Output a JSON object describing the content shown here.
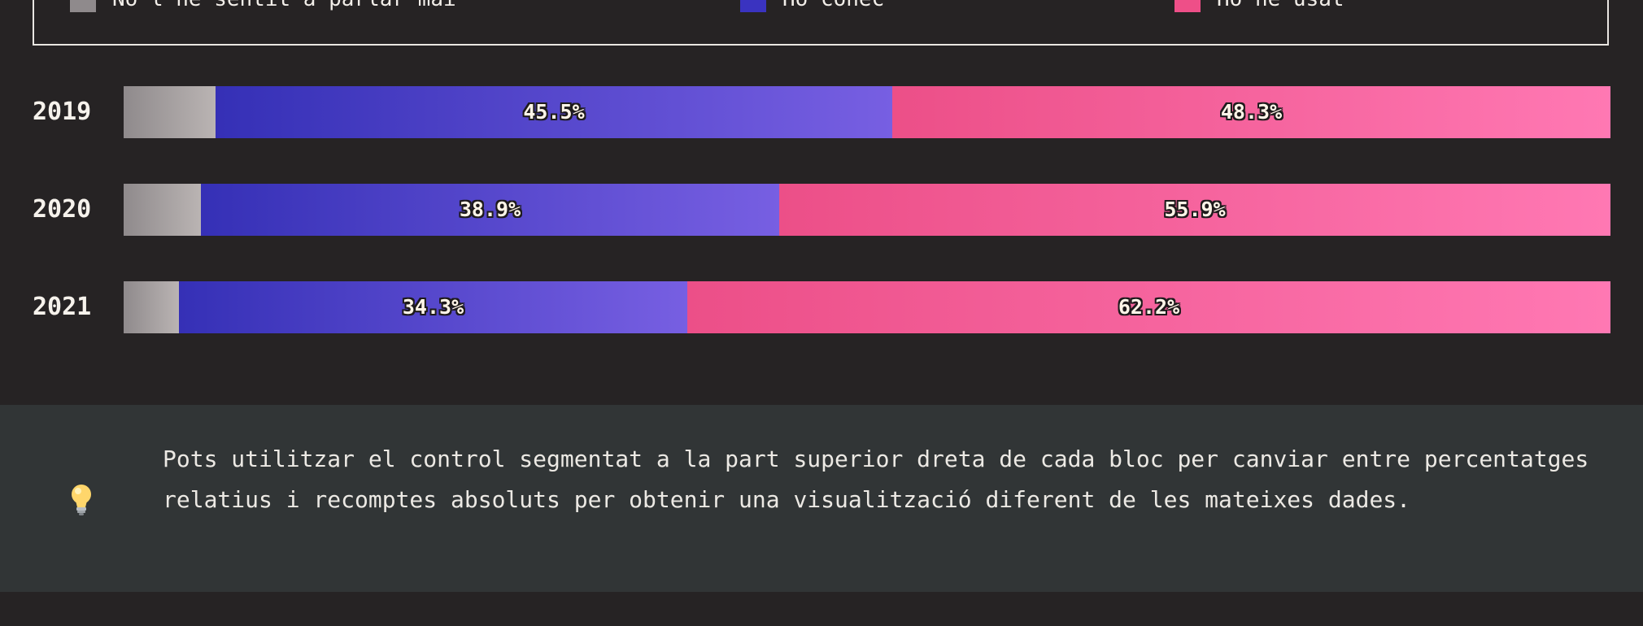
{
  "legend": [
    {
      "label": "No l'he sentit a parlar mai",
      "color": "#8f8a8c"
    },
    {
      "label": "Ho conec",
      "color": "#3a33c0"
    },
    {
      "label": "Ho he usat",
      "color": "#ee4f88"
    }
  ],
  "chart_data": {
    "type": "bar",
    "orientation": "horizontal",
    "stacked": true,
    "normalized": true,
    "categories": [
      "2019",
      "2020",
      "2021"
    ],
    "series": [
      {
        "name": "No l'he sentit a parlar mai",
        "values": [
          6.2,
          5.2,
          3.7
        ],
        "color": "#8f8a8c",
        "value_labels": [
          "",
          "",
          ""
        ]
      },
      {
        "name": "Ho conec",
        "values": [
          45.5,
          38.9,
          34.3
        ],
        "color": "#3a33c0",
        "value_labels": [
          "45.5%",
          "38.9%",
          "34.3%"
        ]
      },
      {
        "name": "Ho he usat",
        "values": [
          48.3,
          55.9,
          62.2
        ],
        "color": "#ee4f88",
        "value_labels": [
          "48.3%",
          "55.9%",
          "62.2%"
        ]
      }
    ],
    "xlim": [
      0,
      100
    ],
    "legend": "top",
    "grid": false
  },
  "tip": {
    "icon": "lightbulb-icon",
    "text": "Pots utilitzar el control segmentat a la part superior dreta de cada bloc per canviar entre percentatges relatius i recomptes absoluts per obtenir una visualització diferent de les mateixes dades."
  }
}
